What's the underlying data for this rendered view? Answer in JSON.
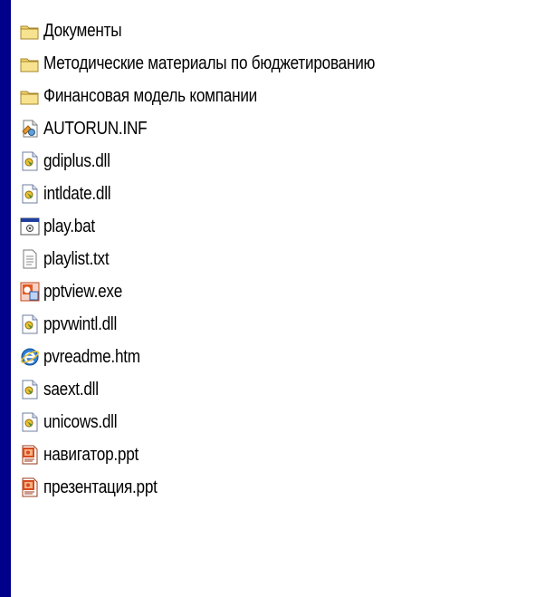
{
  "colors": {
    "background": "#00008a",
    "panel": "#ffffff",
    "folder": "#f2d56b",
    "text": "#000000"
  },
  "files": [
    {
      "name": "Документы",
      "icon": "folder-icon"
    },
    {
      "name": "Методические материалы по бюджетированию",
      "icon": "folder-icon"
    },
    {
      "name": "Финансовая модель компании",
      "icon": "folder-icon"
    },
    {
      "name": "AUTORUN.INF",
      "icon": "setup-info-icon"
    },
    {
      "name": "gdiplus.dll",
      "icon": "dll-icon"
    },
    {
      "name": "intldate.dll",
      "icon": "dll-icon"
    },
    {
      "name": "play.bat",
      "icon": "batch-file-icon"
    },
    {
      "name": "playlist.txt",
      "icon": "text-file-icon"
    },
    {
      "name": "pptview.exe",
      "icon": "powerpoint-viewer-icon"
    },
    {
      "name": "ppvwintl.dll",
      "icon": "dll-icon"
    },
    {
      "name": "pvreadme.htm",
      "icon": "internet-explorer-icon"
    },
    {
      "name": "saext.dll",
      "icon": "dll-icon"
    },
    {
      "name": "unicows.dll",
      "icon": "dll-icon"
    },
    {
      "name": "навигатор.ppt",
      "icon": "powerpoint-file-icon"
    },
    {
      "name": "презентация.ppt",
      "icon": "powerpoint-file-icon"
    }
  ]
}
